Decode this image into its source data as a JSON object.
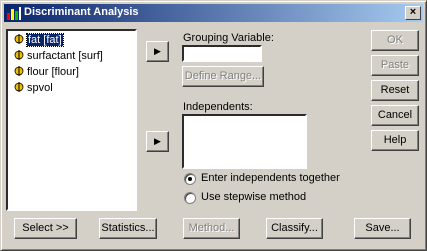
{
  "window": {
    "title": "Discriminant Analysis",
    "close_label": "×"
  },
  "variables": [
    {
      "label": "fat [fat]",
      "selected": true
    },
    {
      "label": "surfactant [surf]",
      "selected": false
    },
    {
      "label": "flour [flour]",
      "selected": false
    },
    {
      "label": "spvol",
      "selected": false
    }
  ],
  "grouping": {
    "label": "Grouping Variable:",
    "value": "",
    "define_range_label": "Define Range..."
  },
  "independents": {
    "label": "Independents:",
    "value": ""
  },
  "arrow_glyph": "▶",
  "method_options": [
    {
      "label": "Enter independents together",
      "checked": true
    },
    {
      "label": "Use stepwise method",
      "checked": false
    }
  ],
  "side_buttons": {
    "ok": "OK",
    "paste": "Paste",
    "reset": "Reset",
    "cancel": "Cancel",
    "help": "Help"
  },
  "bottom_buttons": {
    "select": "Select >>",
    "statistics": "Statistics...",
    "method": "Method...",
    "classify": "Classify...",
    "save": "Save..."
  },
  "colors": {
    "face": "#d4d0c8",
    "title_start": "#0a246a",
    "title_end": "#a6caf0",
    "selection": "#0a246a"
  }
}
